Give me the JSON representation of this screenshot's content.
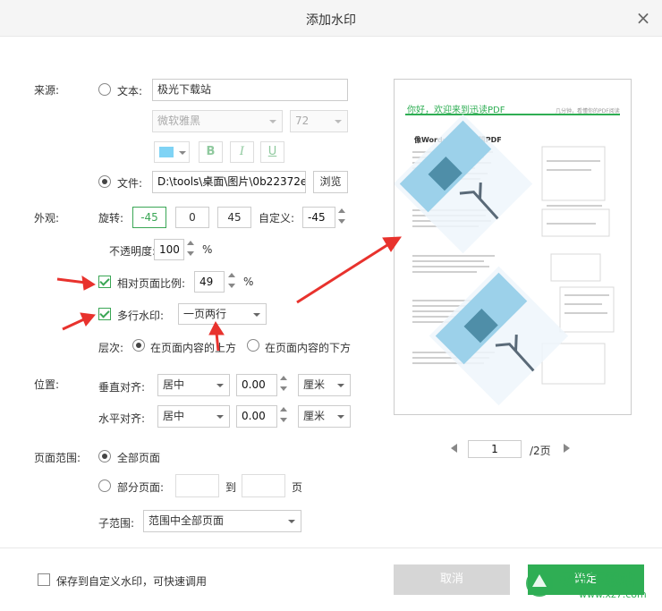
{
  "dialog": {
    "title": "添加水印",
    "close_icon": "×"
  },
  "source": {
    "label": "来源:",
    "text_option": "文本:",
    "text_value": "极光下载站",
    "font": "微软雅黑",
    "font_size": "72",
    "bold": "B",
    "italic": "I",
    "underline": "U",
    "swatch_color": "#7fd3f5",
    "file_option": "文件:",
    "file_value": "D:\\tools\\桌面\\图片\\0b22372e",
    "browse": "浏览"
  },
  "appearance": {
    "label": "外观:",
    "rotate_label": "旋转:",
    "rotate_preset_1": "-45",
    "rotate_preset_2": "0",
    "rotate_preset_3": "45",
    "custom_label": "自定义:",
    "custom_value": "-45",
    "opacity_label": "不透明度:",
    "opacity_value": "100",
    "percent": "%",
    "relative_scale_label": "相对页面比例:",
    "relative_scale_value": "49",
    "multi_label": "多行水印:",
    "multi_value": "一页两行",
    "layer_label": "层次:",
    "layer_above": "在页面内容的上方",
    "layer_below": "在页面内容的下方"
  },
  "position": {
    "label": "位置:",
    "vertical_label": "垂直对齐:",
    "vertical_value": "居中",
    "vertical_offset": "0.00",
    "vertical_unit": "厘米",
    "horizontal_label": "水平对齐:",
    "horizontal_value": "居中",
    "horizontal_offset": "0.00",
    "horizontal_unit": "厘米"
  },
  "range": {
    "label": "页面范围:",
    "all_pages": "全部页面",
    "some_pages": "部分页面:",
    "to": "到",
    "page_unit": "页",
    "subrange_label": "子范围:",
    "subrange_value": "范围中全部页面"
  },
  "preview": {
    "header": "你好，欢迎来到迅读PDF",
    "header_right": "几分钟，看懂你的PDF阅读",
    "heading": "像Word一样自由编辑PDF",
    "page_current": "1",
    "page_total": "/2页",
    "accent": "#2fae54"
  },
  "footer": {
    "save_custom": "保存到自定义水印，可快速调用",
    "cancel": "取消",
    "ok": "确定"
  },
  "overlay": {
    "logo_text": "极光下载站",
    "logo_url": "www.xz7.com"
  }
}
